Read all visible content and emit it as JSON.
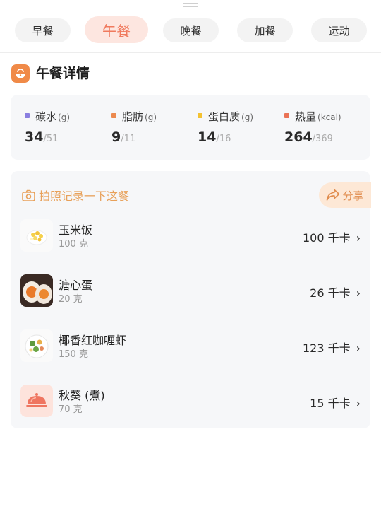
{
  "tabs": [
    {
      "label": "早餐",
      "active": false
    },
    {
      "label": "午餐",
      "active": true
    },
    {
      "label": "晚餐",
      "active": false
    },
    {
      "label": "加餐",
      "active": false
    },
    {
      "label": "运动",
      "active": false
    }
  ],
  "section": {
    "title": "午餐详情",
    "icon": "meal-bowl-icon",
    "accent": "#f08a48"
  },
  "nutrition": [
    {
      "label": "碳水",
      "unit": "(g)",
      "value": "34",
      "goal": "/51",
      "color": "#8a7fe0"
    },
    {
      "label": "脂肪",
      "unit": "(g)",
      "value": "9",
      "goal": "/11",
      "color": "#ec8a4f"
    },
    {
      "label": "蛋白质",
      "unit": "(g)",
      "value": "14",
      "goal": "/16",
      "color": "#f4c231"
    },
    {
      "label": "热量",
      "unit": "(kcal)",
      "value": "264",
      "goal": "/369",
      "color": "#ea7356"
    }
  ],
  "photo_prompt": "拍照记录一下这餐",
  "share_label": "分享",
  "foods": [
    {
      "name": "玉米饭",
      "qty": "100 克",
      "kcal": "100 千卡",
      "icon": "corn-rice-icon"
    },
    {
      "name": "溏心蛋",
      "qty": "20 克",
      "kcal": "26 千卡",
      "icon": "soft-boiled-egg-icon"
    },
    {
      "name": "椰香红咖喱虾",
      "qty": "150 克",
      "kcal": "123 千卡",
      "icon": "curry-shrimp-icon"
    },
    {
      "name": "秋葵 (煮)",
      "qty": "70 克",
      "kcal": "15 千卡",
      "icon": "food-cloche-icon"
    }
  ],
  "chevron": "›"
}
